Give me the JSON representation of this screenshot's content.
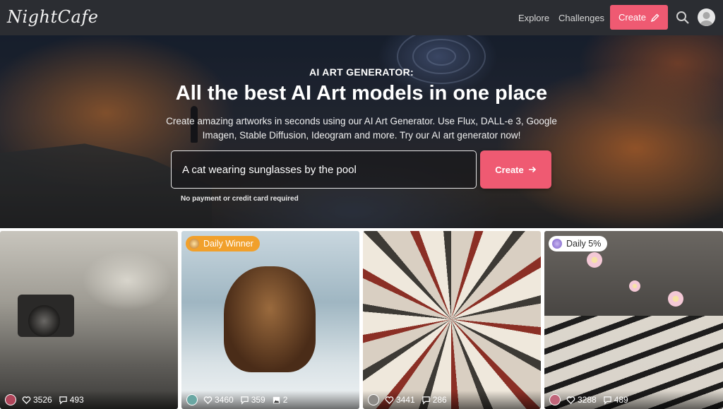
{
  "nav": {
    "logo": "NightCafe",
    "links": [
      "Explore",
      "Challenges"
    ],
    "create_label": "Create"
  },
  "hero": {
    "kicker": "AI ART GENERATOR:",
    "title": "All the best AI Art models in one place",
    "description": "Create amazing artworks in seconds using our AI Art Generator. Use Flux, DALL-e 3, Google Imagen, Stable Diffusion, Ideogram and more. Try our AI art generator now!",
    "prompt_value": "A cat wearing sunglasses by the pool",
    "create_label": "Create",
    "no_payment": "No payment or credit card required"
  },
  "gallery": [
    {
      "likes": "3526",
      "comments": "493"
    },
    {
      "badge": "Daily Winner",
      "likes": "3460",
      "comments": "359",
      "images": "2"
    },
    {
      "likes": "3441",
      "comments": "286"
    },
    {
      "badge": "Daily 5%",
      "likes": "3288",
      "comments": "489"
    }
  ],
  "colors": {
    "accent": "#ef5a72",
    "nav_bg": "#2b2d32",
    "badge_winner": "#f1a02b"
  }
}
